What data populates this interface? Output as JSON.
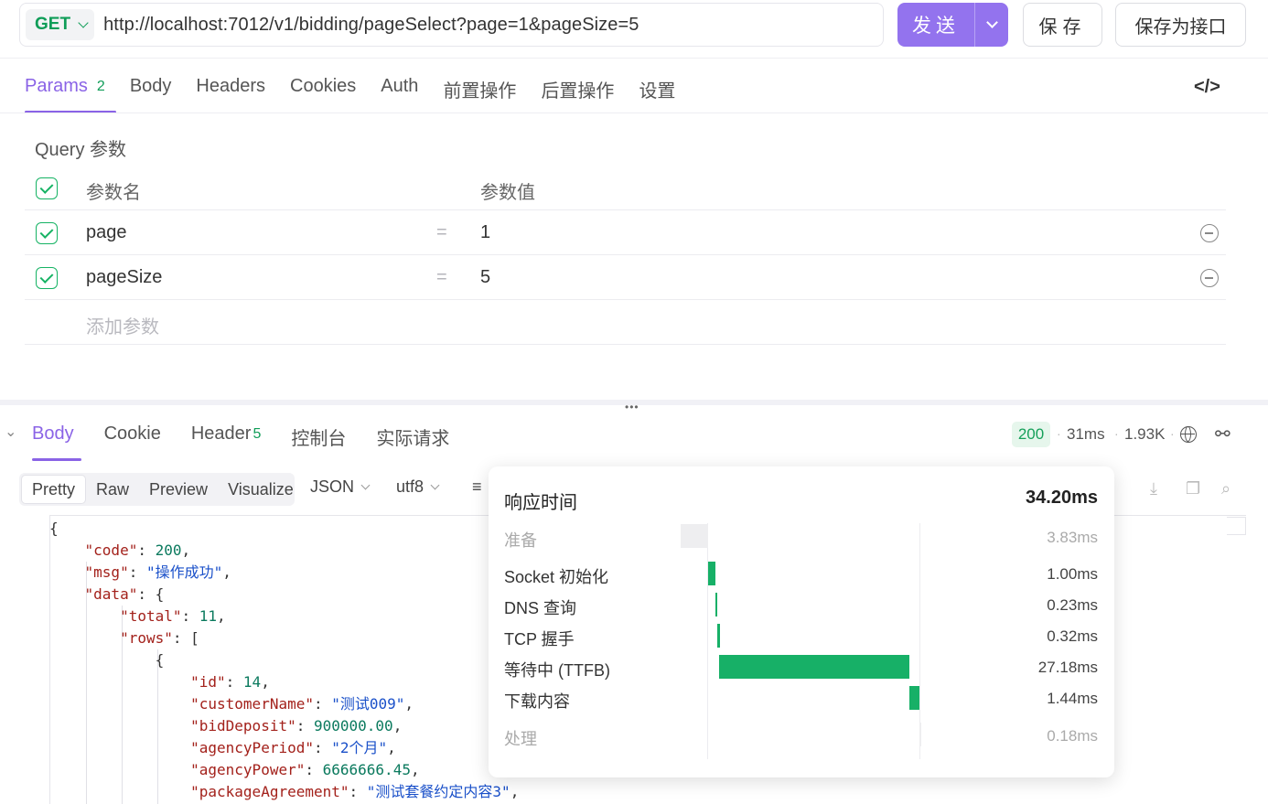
{
  "request": {
    "method": "GET",
    "url": "http://localhost:7012/v1/bidding/pageSelect?page=1&pageSize=5",
    "send_label": "发送",
    "save_label": "保存",
    "save_api_label": "保存为接口"
  },
  "req_tabs": [
    {
      "label": "Params",
      "badge": "2"
    },
    {
      "label": "Body"
    },
    {
      "label": "Headers"
    },
    {
      "label": "Cookies"
    },
    {
      "label": "Auth"
    },
    {
      "label": "前置操作"
    },
    {
      "label": "后置操作"
    },
    {
      "label": "设置"
    }
  ],
  "code_icon": "</>",
  "query": {
    "title": "Query 参数",
    "header_name": "参数名",
    "header_value": "参数值",
    "params": [
      {
        "name": "page",
        "value": "1"
      },
      {
        "name": "pageSize",
        "value": "5"
      }
    ],
    "add_placeholder": "添加参数"
  },
  "resp_tabs": [
    {
      "label": "Body"
    },
    {
      "label": "Cookie"
    },
    {
      "label": "Header",
      "badge": "5"
    },
    {
      "label": "控制台"
    },
    {
      "label": "实际请求"
    }
  ],
  "response_meta": {
    "status": "200",
    "time": "31ms",
    "size": "1.93K"
  },
  "format": {
    "modes": [
      "Pretty",
      "Raw",
      "Preview",
      "Visualize"
    ],
    "type": "JSON",
    "encoding": "utf8"
  },
  "timing": {
    "title": "响应时间",
    "total": "34.20ms",
    "phases": [
      {
        "label": "准备",
        "value": "3.83ms"
      },
      {
        "label": "Socket 初始化",
        "value": "1.00ms"
      },
      {
        "label": "DNS 查询",
        "value": "0.23ms"
      },
      {
        "label": "TCP 握手",
        "value": "0.32ms"
      },
      {
        "label": "等待中 (TTFB)",
        "value": "27.18ms"
      },
      {
        "label": "下载内容",
        "value": "1.44ms"
      },
      {
        "label": "处理",
        "value": "0.18ms"
      }
    ]
  },
  "body_json": {
    "code": "200",
    "msg": "\"操作成功\"",
    "total": "11",
    "id": "14",
    "customerName": "\"测试009\"",
    "bidDeposit": "900000.00",
    "agencyPeriod": "\"2个月\"",
    "agencyPower": "6666666.45",
    "packageAgreement": "\"测试套餐约定内容3\""
  }
}
